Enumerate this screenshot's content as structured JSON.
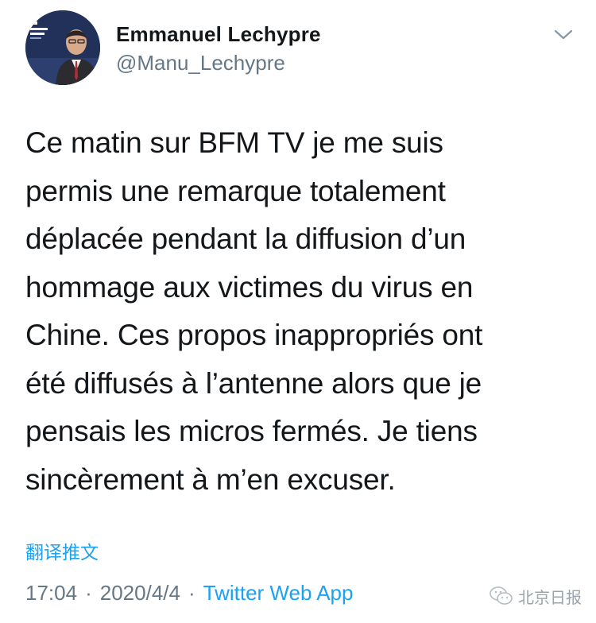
{
  "tweet": {
    "author": {
      "display_name": "Emmanuel Lechypre",
      "handle": "@Manu_Lechypre",
      "avatar_icon": "profile-photo"
    },
    "menu_icon": "chevron-down-icon",
    "text": "Ce matin sur BFM TV je me suis\npermis une remarque totalement\ndéplacée pendant la diffusion d’un\nhommage aux victimes du virus en\nChine. Ces propos inappropriés ont\nété diffusés à l’antenne alors que je\npensais les micros fermés. Je tiens\nsincèrement à m’en excuser.",
    "translate_label": "翻译推文",
    "time": "17:04",
    "date": "2020/4/4",
    "separator": "·",
    "source": "Twitter Web App"
  },
  "watermark": {
    "icon": "wechat-icon",
    "label": "北京日报"
  },
  "colors": {
    "link": "#1da1f2",
    "secondary_text": "#657786",
    "primary_text": "#14171a"
  }
}
